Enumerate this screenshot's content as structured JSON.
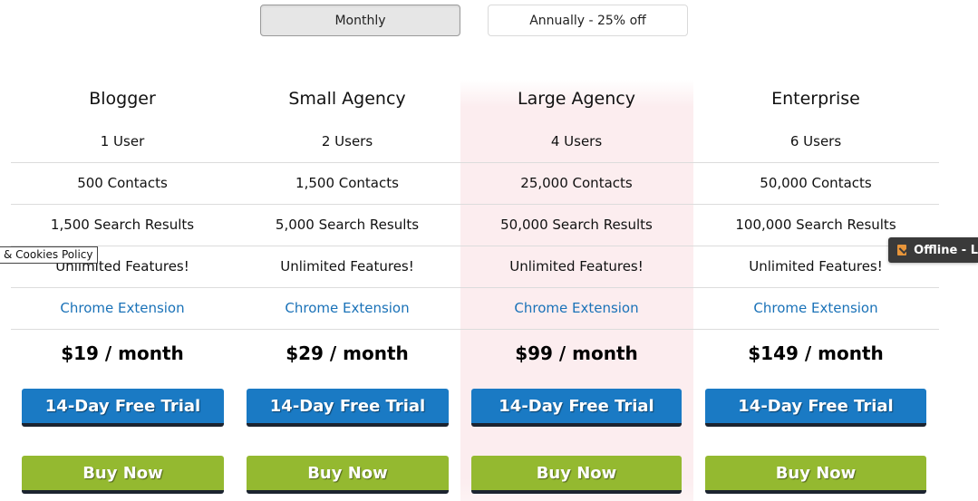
{
  "billing_toggle": {
    "monthly_label": "Monthly",
    "annual_label": "Annually - 25% off",
    "selected": "Monthly"
  },
  "plans": [
    {
      "name": "Blogger",
      "users": "1 User",
      "contacts": "500 Contacts",
      "search_results": "1,500 Search Results",
      "features": "Unlimited Features!",
      "extension": "Chrome Extension",
      "price": "$19 / month",
      "trial_label": "14-Day Free Trial",
      "buy_label": "Buy Now"
    },
    {
      "name": "Small Agency",
      "users": "2 Users",
      "contacts": "1,500 Contacts",
      "search_results": "5,000 Search Results",
      "features": "Unlimited Features!",
      "extension": "Chrome Extension",
      "price": "$29 / month",
      "trial_label": "14-Day Free Trial",
      "buy_label": "Buy Now"
    },
    {
      "name": "Large Agency",
      "users": "4 Users",
      "contacts": "25,000 Contacts",
      "search_results": "50,000 Search Results",
      "features": "Unlimited Features!",
      "extension": "Chrome Extension",
      "price": "$99 / month",
      "trial_label": "14-Day Free Trial",
      "buy_label": "Buy Now",
      "highlighted": true
    },
    {
      "name": "Enterprise",
      "users": "6 Users",
      "contacts": "50,000 Contacts",
      "search_results": "100,000 Search Results",
      "features": "Unlimited Features!",
      "extension": "Chrome Extension",
      "price": "$149 / month",
      "trial_label": "14-Day Free Trial",
      "buy_label": "Buy Now"
    }
  ],
  "cookie_banner": {
    "label": "& Cookies Policy"
  },
  "chat_widget": {
    "icon": "envelope-icon",
    "label": "Offline - L"
  },
  "colors": {
    "trial_button": "#1a7ac4",
    "buy_button": "#94b930",
    "link": "#1a72b8",
    "highlight_bg": "#fcedef",
    "chat_icon": "#e8953a"
  }
}
